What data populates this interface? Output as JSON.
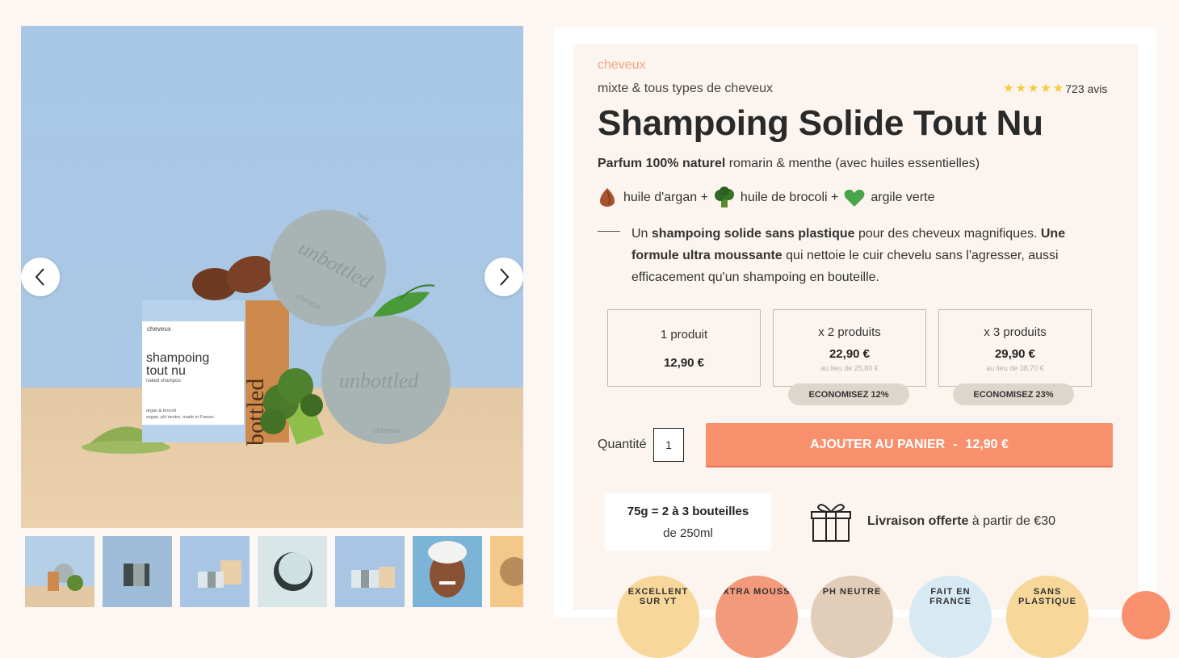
{
  "gallery": {
    "prev_icon": "chevron-left-icon",
    "next_icon": "chevron-right-icon",
    "box_category": "cheveux",
    "box_title_1": "shampoing",
    "box_title_2": "tout nu",
    "box_subtitle": "naked shampoo",
    "box_small_1": "argan & brocoli",
    "box_small_2": "vegan, pH neutre, made in France.",
    "box_side": "bottled",
    "bar_brand": "unbottled",
    "bar_tag_hair": "hair",
    "bar_tag_cheveux": "cheveux",
    "thumb_count": 7
  },
  "product": {
    "category": "cheveux",
    "subtitle": "mixte & tous types de cheveux",
    "rating_stars": 5,
    "reviews": "723 avis",
    "title": "Shampoing Solide Tout Nu",
    "perfume_bold": "Parfum 100% naturel",
    "perfume_rest": " romarin & menthe (avec huiles essentielles)",
    "ingredients": [
      {
        "icon": "almond-icon",
        "label": "huile d'argan +"
      },
      {
        "icon": "broccoli-icon",
        "label": "huile de brocoli +"
      },
      {
        "icon": "heart-icon",
        "label": "argile verte"
      }
    ],
    "desc_1": "Un ",
    "desc_2": "shampoing solide sans plastique",
    "desc_3": " pour des cheveux magnifiques. ",
    "desc_4": "Une formule ultra moussante",
    "desc_5": " qui nettoie le cuir chevelu sans l'agresser, aussi efficacement qu'un shampoing en bouteille."
  },
  "options": [
    {
      "label": "1 produit",
      "price": "12,90 €",
      "old": "",
      "badge": ""
    },
    {
      "label": "x 2 produits",
      "price": "22,90 €",
      "old": "au lieu de 25,80 €",
      "badge": "ECONOMISEZ 12%"
    },
    {
      "label": "x 3 produits",
      "price": "29,90 €",
      "old": "au lieu de 38,70 €",
      "badge": "ECONOMISEZ 23%"
    }
  ],
  "purchase": {
    "qty_label": "Quantité",
    "qty_value": "1",
    "cart_label": "AJOUTER AU PANIER",
    "cart_sep": "-",
    "cart_price": "12,90 €"
  },
  "info": {
    "equiv_1": "75g = 2 à 3 bouteilles",
    "equiv_2": "de 250ml",
    "gift_icon": "gift-icon",
    "delivery_bold": "Livraison offerte",
    "delivery_rest": " à partir de €30"
  },
  "seals": [
    {
      "label": "EXCELLENT SUR YT",
      "color": "#f7d79a"
    },
    {
      "label": "EXTRA MOUSSE",
      "color": "#f39a7c"
    },
    {
      "label": "PH NEUTRE",
      "color": "#e2cdb8"
    },
    {
      "label": "FAIT EN FRANCE",
      "color": "#d7e9f3"
    },
    {
      "label": "SANS PLASTIQUE",
      "color": "#f7d79a"
    }
  ],
  "colors": {
    "accent": "#f8906e",
    "category": "#f3a386",
    "badge_bg": "#ddd6cc",
    "star": "#f5cb3a",
    "sky": "#a8c7e6"
  }
}
